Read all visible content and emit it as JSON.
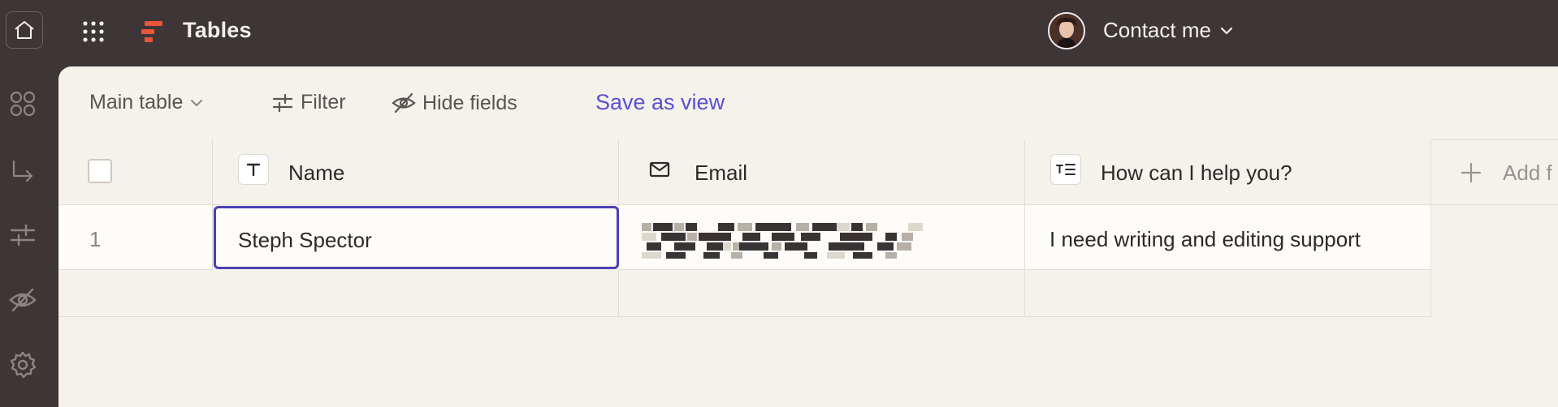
{
  "header": {
    "app_title": "Tables",
    "contact_label": "Contact me",
    "icons": [
      "home-icon",
      "apps-grid-icon",
      "tables-logo-icon",
      "chevron-down-icon"
    ]
  },
  "sidebar": {
    "icons": [
      "interfaces-icon",
      "zap-icon",
      "filter-icon",
      "hide-icon",
      "settings-icon"
    ]
  },
  "toolbar": {
    "view_select": "Main table",
    "filter_label": "Filter",
    "hide_fields_label": "Hide fields",
    "save_view_label": "Save as view"
  },
  "table": {
    "columns": [
      {
        "label": "Name",
        "icon": "text-field-icon"
      },
      {
        "label": "Email",
        "icon": "mail-icon"
      },
      {
        "label": "How can I help you?",
        "icon": "long-text-icon"
      }
    ],
    "add_field_label": "Add f",
    "rows": [
      {
        "index": "1",
        "name": "Steph Spector",
        "email": "",
        "help": "I need writing and editing support"
      }
    ]
  },
  "colors": {
    "topbar": "#3e3636",
    "panel": "#f5f2ec",
    "accent": "#5b4fd0",
    "selection": "#4b40b4",
    "logo": "#e8553a"
  }
}
